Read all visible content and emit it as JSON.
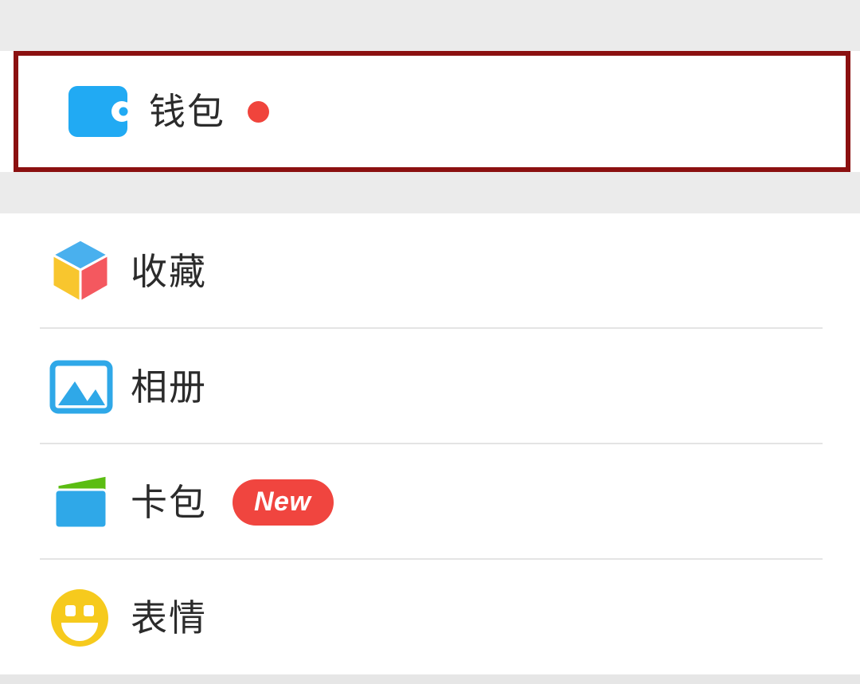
{
  "screen": {
    "app": "WeChat Me tab",
    "background_color": "#ffffff",
    "band_color": "#ebebeb"
  },
  "highlight": {
    "name": "red-annotation-box",
    "color": "#8b1010",
    "target": "wallet-row"
  },
  "groups": [
    {
      "id": "wallet-group",
      "highlighted": true,
      "items": [
        {
          "id": "wallet",
          "label": "钱包",
          "icon": "wallet-icon",
          "icon_colors": [
            "#21aaf3",
            "#ffffff"
          ],
          "badge_type": "dot",
          "badge_label": "",
          "badge_color": "#f0443c"
        }
      ]
    },
    {
      "id": "main-group",
      "highlighted": false,
      "items": [
        {
          "id": "favorites",
          "label": "收藏",
          "icon": "cube-icon",
          "icon_colors": [
            "#49b0ee",
            "#f8c62e",
            "#f4585f"
          ],
          "badge_type": "none",
          "badge_label": "",
          "badge_color": ""
        },
        {
          "id": "album",
          "label": "相册",
          "icon": "photo-icon",
          "icon_colors": [
            "#2fa8e8"
          ],
          "badge_type": "none",
          "badge_label": "",
          "badge_color": ""
        },
        {
          "id": "cards",
          "label": "卡包",
          "icon": "cards-icon",
          "icon_colors": [
            "#2fa8e8",
            "#5bbd12"
          ],
          "badge_type": "pill",
          "badge_label": "New",
          "badge_color": "#f0453f"
        },
        {
          "id": "emoji",
          "label": "表情",
          "icon": "smiley-icon",
          "icon_colors": [
            "#f6ca1d"
          ],
          "badge_type": "none",
          "badge_label": "",
          "badge_color": ""
        }
      ]
    }
  ]
}
